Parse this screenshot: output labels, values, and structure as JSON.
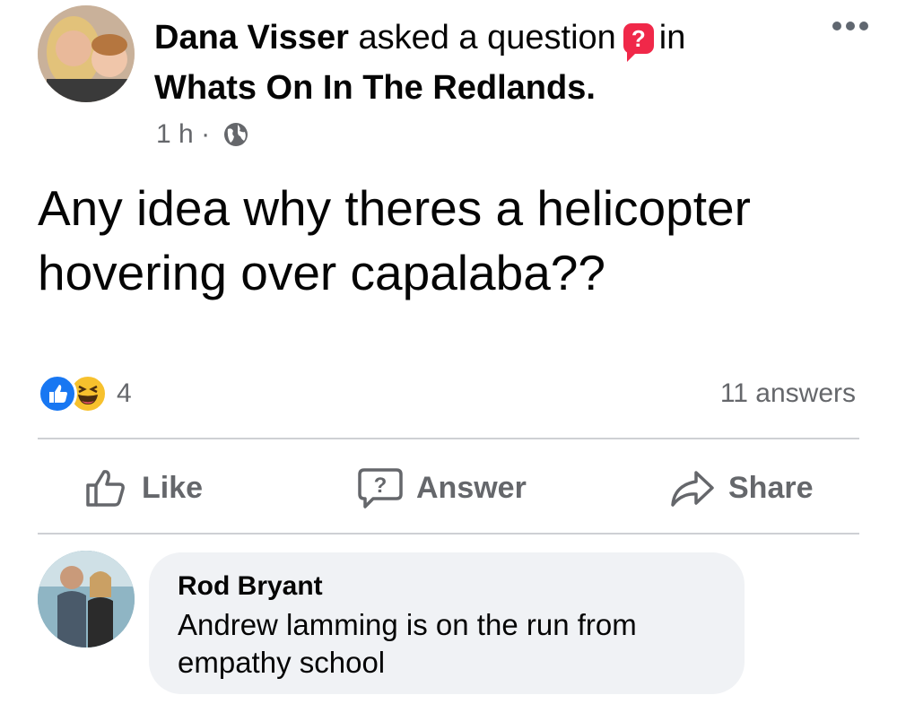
{
  "post": {
    "author": "Dana Visser",
    "action_text": "asked a question",
    "badge_icon": "?",
    "in_text": "in",
    "group": "Whats On In The Redlands.",
    "time": "1 h",
    "separator": "·",
    "audience_icon": "globe-icon",
    "question": "Any idea why theres a helicopter hovering over capalaba??",
    "reaction_count": "4",
    "answers_count": "11 answers"
  },
  "actions": {
    "like_label": "Like",
    "answer_label": "Answer",
    "share_label": "Share"
  },
  "comment": {
    "author": "Rod Bryant",
    "text": "Andrew lamming is on the run from empathy school"
  },
  "colors": {
    "like_blue": "#1877f2",
    "haha_yellow": "#f7c12d",
    "question_badge_red": "#f02849",
    "secondary_text": "#65676b",
    "bubble_bg": "#f0f2f5"
  }
}
